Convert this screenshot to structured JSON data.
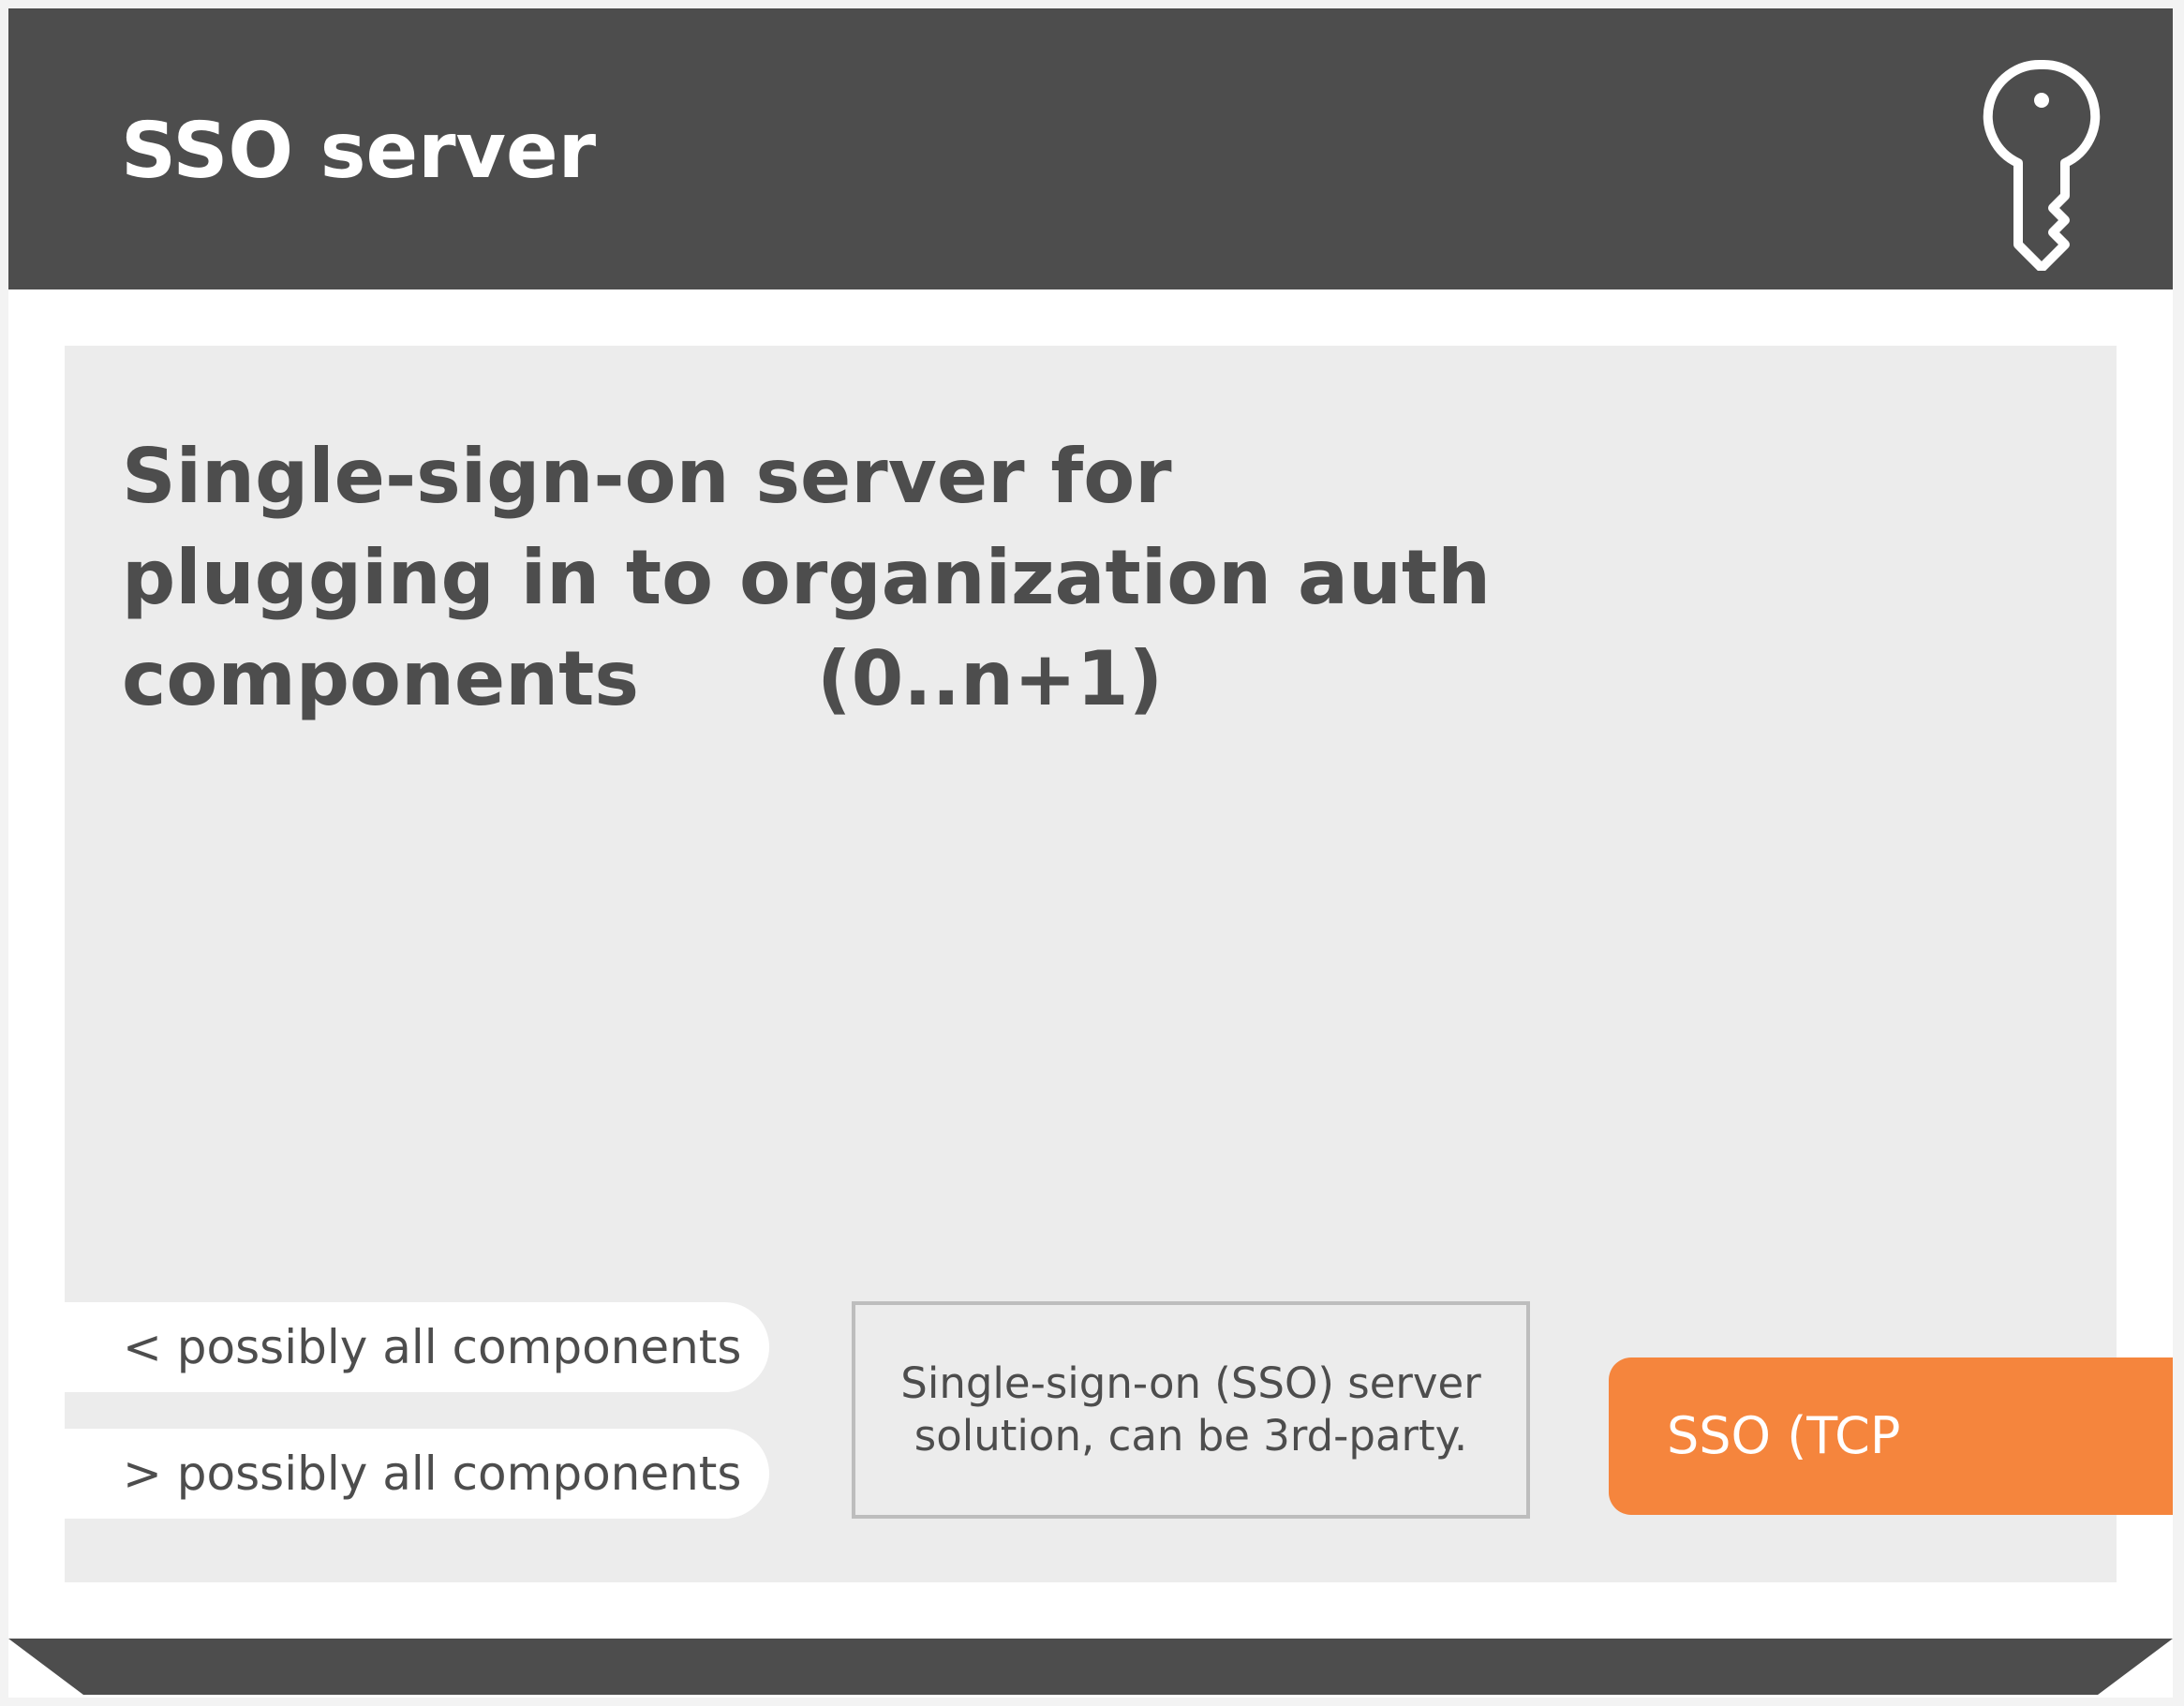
{
  "header": {
    "title": "SSO server",
    "icon": "key-icon",
    "background": "#4d4d4d"
  },
  "description": {
    "lines": [
      "Single-sign-on server for",
      "plugging in to organization auth",
      "components"
    ],
    "multiplicity": "(0..n+1)"
  },
  "connectors": {
    "incoming": "< possibly all components",
    "outgoing": "> possibly all components"
  },
  "note": {
    "lines": [
      "Single-sign-on (SSO) server",
      "solution, can be 3rd-party."
    ]
  },
  "protocol_tab": {
    "label": "SSO (TCP",
    "color": "#f5853d"
  },
  "colors": {
    "panel": "#ececec",
    "text": "#4d4d4d",
    "border": "#bdbdbd"
  }
}
